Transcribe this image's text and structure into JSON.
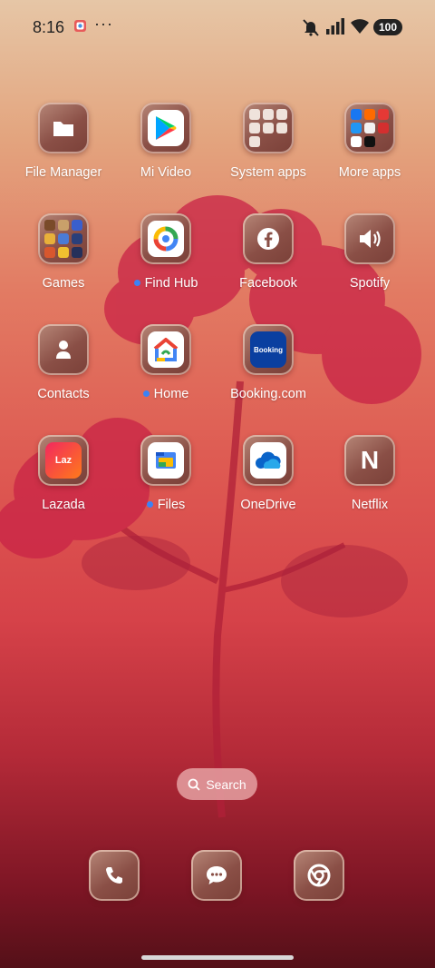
{
  "status_bar": {
    "time": "8:16",
    "more": "···",
    "battery": "100"
  },
  "apps": [
    {
      "label": "File Manager"
    },
    {
      "label": "Mi Video"
    },
    {
      "label": "System apps"
    },
    {
      "label": "More apps"
    },
    {
      "label": "Games"
    },
    {
      "label": "Find Hub"
    },
    {
      "label": "Facebook"
    },
    {
      "label": "Spotify"
    },
    {
      "label": "Contacts"
    },
    {
      "label": "Home"
    },
    {
      "label": "Booking.com",
      "icon_text": "Booking"
    },
    {
      "label": "Lazada",
      "icon_text": "Laz"
    },
    {
      "label": "Files"
    },
    {
      "label": "OneDrive"
    },
    {
      "label": "Netflix",
      "icon_text": "N"
    }
  ],
  "search": {
    "label": "Search"
  },
  "dock": [
    {
      "icon": "phone-icon"
    },
    {
      "icon": "messages-icon"
    },
    {
      "icon": "chrome-icon"
    }
  ],
  "colors": {
    "notification_dot": "#3b82f6",
    "booking_blue": "#0a3fa0"
  }
}
